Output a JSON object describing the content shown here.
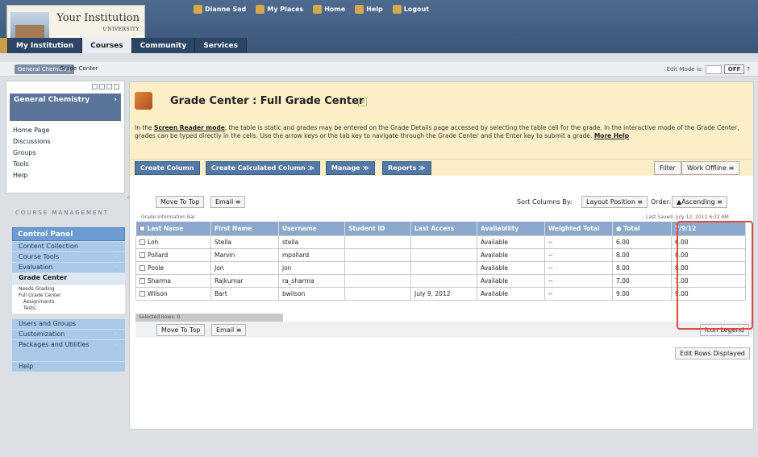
{
  "header": {
    "institution_name": "Your Institution",
    "institution_sub": "UNIVERSITY",
    "user": "Dianne Sad",
    "util_links": [
      "My Places",
      "Home",
      "Help",
      "Logout"
    ],
    "tabs": [
      "My Institution",
      "Courses",
      "Community",
      "Services"
    ]
  },
  "breadcrumb": {
    "course": "General Chemistry",
    "current": "Grade Center",
    "edit_mode_label": "Edit Mode is:",
    "edit_mode_value": "OFF"
  },
  "sidebar": {
    "course_title": "General Chemistry",
    "course_links": [
      "Home Page",
      "Discussions",
      "Groups",
      "Tools",
      "Help"
    ],
    "course_management_title": "COURSE MANAGEMENT",
    "control_panel": "Control Panel",
    "items": [
      "Content Collection",
      "Course Tools",
      "Evaluation",
      "Grade Center"
    ],
    "grade_center_sub": [
      "Needs Grading",
      "Full Grade Center",
      "Assignments",
      "Tests"
    ],
    "items_after": [
      "Users and Groups",
      "Customization",
      "Packages and Utilities",
      "Help"
    ]
  },
  "main": {
    "title": "Grade Center : Full Grade Center",
    "help_prefix": "In the ",
    "help_link1": "Screen Reader mode",
    "help_body": ", the table is static and grades may be entered on the Grade Details page accessed by selecting the table cell for the grade. In the interactive mode of the Grade Center, grades can be typed directly in the cells. Use the arrow keys or the tab key to navigate through the Grade Center and the Enter key to submit a grade. ",
    "help_link2": "More Help",
    "actions": [
      "Create Column",
      "Create Calculated Column",
      "Manage",
      "Reports"
    ],
    "right_actions": [
      "Filter",
      "Work Offline"
    ],
    "move_to_top": "Move To Top",
    "email": "Email",
    "sort_label": "Sort Columns By:",
    "sort_value": "Layout Position",
    "order_label": "Order:",
    "order_value": "▲Ascending",
    "info_bar": "Grade Information Bar",
    "last_saved": "Last Saved: July 12, 2012 6:32 AM",
    "columns": [
      "Last Name",
      "First Name",
      "Username",
      "Student ID",
      "Last Access",
      "Availability",
      "Weighted Total",
      "Total",
      "7/9/12"
    ],
    "rows": [
      [
        "Loh",
        "Stella",
        "stella",
        "",
        "",
        "Available",
        "--",
        "6.00",
        "6.00"
      ],
      [
        "Pollard",
        "Marvin",
        "mpollard",
        "",
        "",
        "Available",
        "--",
        "8.00",
        "8.00"
      ],
      [
        "Poole",
        "Jon",
        "jon",
        "",
        "",
        "Available",
        "--",
        "8.00",
        "8.00"
      ],
      [
        "Sharma",
        "Rajkumar",
        "ra_sharma",
        "",
        "",
        "Available",
        "--",
        "7.00",
        "7.00"
      ],
      [
        "Wilson",
        "Bart",
        "bwilson",
        "",
        "July 9, 2012",
        "Available",
        "--",
        "9.00",
        "9.00"
      ]
    ],
    "selected_rows": "Selected Rows: 0",
    "icon_legend": "Icon Legend",
    "edit_rows": "Edit Rows Displayed"
  }
}
